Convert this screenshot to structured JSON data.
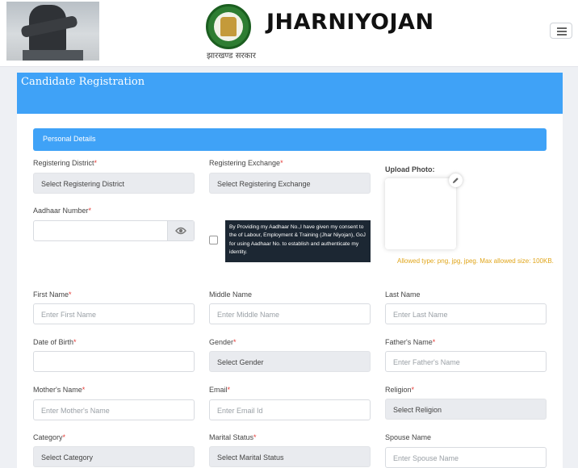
{
  "header": {
    "brand": "JHARNIYOJAN",
    "gov_text": "झारखण्ड सरकार"
  },
  "card": {
    "title": "Candidate Registration"
  },
  "section": {
    "title": "Personal Details"
  },
  "fields": {
    "registering_district": {
      "label": "Registering District",
      "required": "*",
      "value": "Select Registering District"
    },
    "registering_exchange": {
      "label": "Registering Exchange",
      "required": "*",
      "value": "Select Registering Exchange"
    },
    "aadhaar": {
      "label": "Aadhaar Number",
      "required": "*",
      "value": ""
    },
    "first_name": {
      "label": "First Name",
      "required": "*",
      "placeholder": "Enter First Name"
    },
    "middle_name": {
      "label": "Middle Name",
      "placeholder": "Enter Middle Name"
    },
    "last_name": {
      "label": "Last Name",
      "placeholder": "Enter Last Name"
    },
    "dob": {
      "label": "Date of Birth",
      "required": "*",
      "value": ""
    },
    "gender": {
      "label": "Gender",
      "required": "*",
      "value": "Select Gender"
    },
    "father_name": {
      "label": "Father's Name",
      "required": "*",
      "placeholder": "Enter Father's Name"
    },
    "mother_name": {
      "label": "Mother's Name",
      "required": "*",
      "placeholder": "Enter Mother's Name"
    },
    "email": {
      "label": "Email",
      "required": "*",
      "placeholder": "Enter Email Id"
    },
    "religion": {
      "label": "Religion",
      "required": "*",
      "value": "Select Religion"
    },
    "category": {
      "label": "Category",
      "required": "*",
      "value": "Select Category"
    },
    "marital_status": {
      "label": "Marital Status",
      "required": "*",
      "value": "Select Marital Status"
    },
    "spouse_name": {
      "label": "Spouse Name",
      "placeholder": "Enter Spouse Name"
    }
  },
  "consent": {
    "text": "By Providing my Aadhaar No.,I have given my consent to the of Labour, Employment & Training (Jhar Niyojan), GoJ for using Aadhaar No. to establish and authenticate my identity."
  },
  "upload": {
    "label": "Upload Photo:",
    "hint": "Allowed type: png, jpg, jpeg.   Max allowed size: 100KB."
  },
  "icons": {
    "eye": "eye-icon",
    "edit": "pencil-icon",
    "menu": "hamburger-icon"
  },
  "colors": {
    "primary": "#3fa2f7",
    "required": "#e53935",
    "hint": "#e0a51a",
    "tooltip_bg": "#1c2733"
  }
}
